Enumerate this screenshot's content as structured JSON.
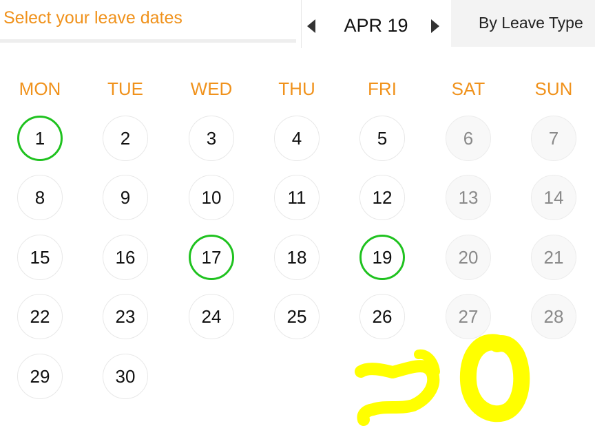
{
  "header": {
    "placeholder": "Select your leave dates",
    "month": "APR 19",
    "leave_type_button": "By Leave Type"
  },
  "calendar": {
    "weekdays": [
      "MON",
      "TUE",
      "WED",
      "THU",
      "FRI",
      "SAT",
      "SUN"
    ],
    "days": [
      "1",
      "2",
      "3",
      "4",
      "5",
      "6",
      "7",
      "8",
      "9",
      "10",
      "11",
      "12",
      "13",
      "14",
      "15",
      "16",
      "17",
      "18",
      "19",
      "20",
      "21",
      "22",
      "23",
      "24",
      "25",
      "26",
      "27",
      "28",
      "29",
      "30"
    ],
    "selected_days": [
      "1",
      "17",
      "19"
    ],
    "weekend_columns": [
      "SAT",
      "SUN"
    ]
  },
  "annotation": {
    "text": "20",
    "color": "#ffff00"
  },
  "colors": {
    "accent": "#f0921c",
    "selected_ring": "#1fc21f"
  }
}
